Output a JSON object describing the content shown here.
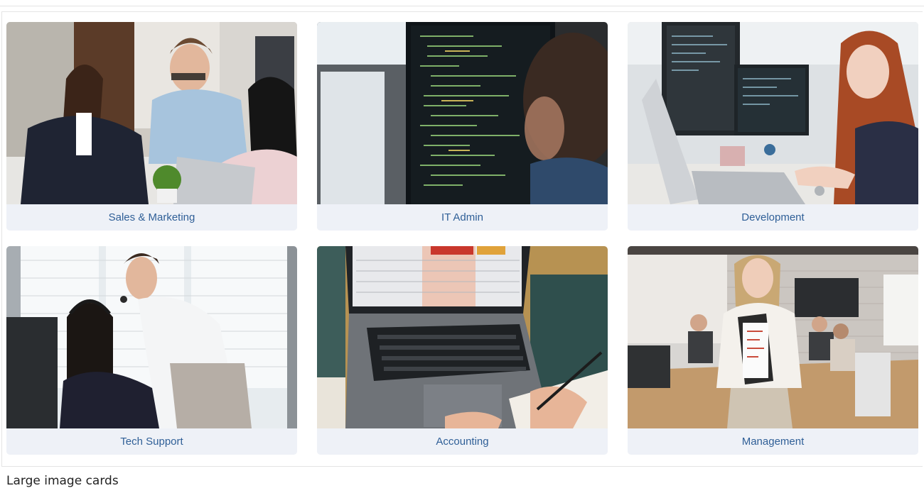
{
  "cards": [
    {
      "label": "Sales & Marketing",
      "image": "team-meeting-photo"
    },
    {
      "label": "IT Admin",
      "image": "code-monitor-photo"
    },
    {
      "label": "Development",
      "image": "developer-desk-photo"
    },
    {
      "label": "Tech Support",
      "image": "support-headset-photo"
    },
    {
      "label": "Accounting",
      "image": "laptop-accounting-photo"
    },
    {
      "label": "Management",
      "image": "manager-office-photo"
    }
  ],
  "caption": "Large image cards"
}
